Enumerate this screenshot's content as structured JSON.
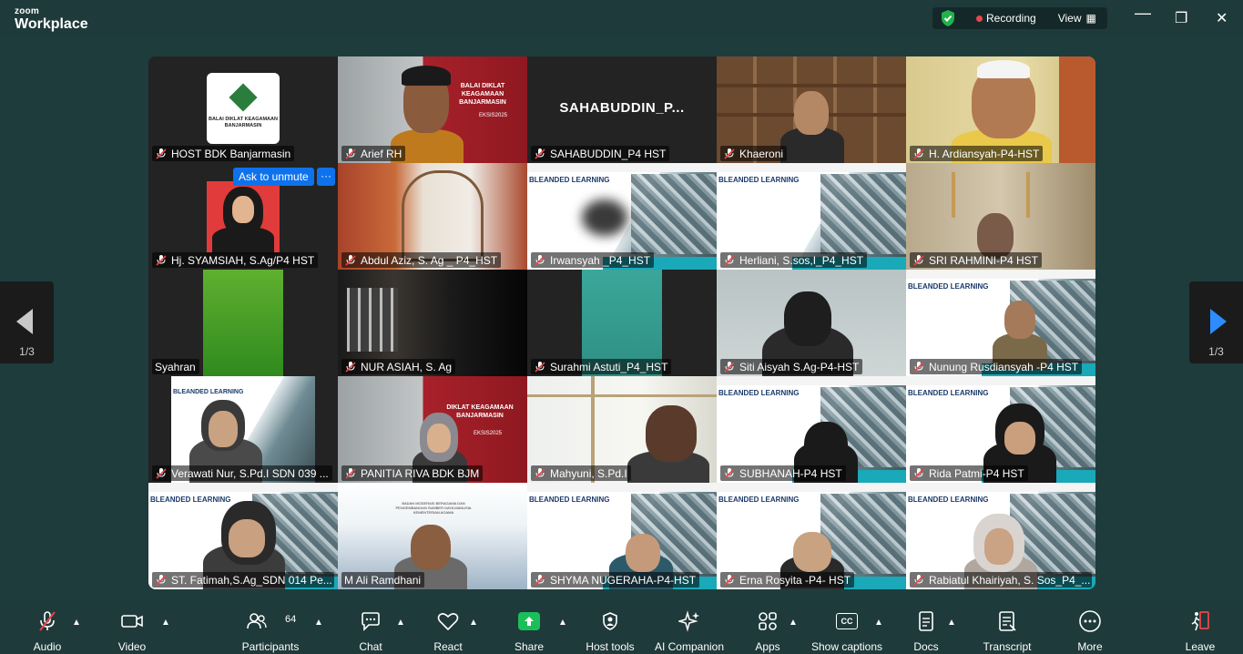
{
  "app": {
    "brand_small": "zoom",
    "brand_large": "Workplace"
  },
  "header": {
    "recording_label": "Recording",
    "view_label": "View"
  },
  "gallery": {
    "page_left": "1/3",
    "page_right": "1/3",
    "tiles": [
      {
        "name": "HOST BDK Banjarmasin",
        "logo_text": "BALAI DIKLAT KEAGAMAAN BANJARMASIN"
      },
      {
        "name": "Arief RH",
        "slide_title": "BALAI DIKLAT KEAGAMAAN BANJARMASIN",
        "slide_sub": "EKSIS2025"
      },
      {
        "name": "SAHABUDDIN_P4 HST",
        "big_name": "SAHABUDDIN_P..."
      },
      {
        "name": "Khaeroni"
      },
      {
        "name": "H. Ardiansyah-P4-HST"
      },
      {
        "name": "Hj. SYAMSIAH, S.Ag/P4 HST",
        "ask_unmute": "Ask to unmute",
        "more": "···"
      },
      {
        "name": "Abdul Aziz, S. Ag _ P4_HST"
      },
      {
        "name": "Irwansyah _P4_HST",
        "slide_title": "BLEANDED LEARNING"
      },
      {
        "name": "Herliani, S.sos,I_P4_HST",
        "slide_title": "BLEANDED LEARNING"
      },
      {
        "name": "SRI RAHMINI-P4 HST"
      },
      {
        "name": "Syahran"
      },
      {
        "name": "NUR ASIAH, S. Ag"
      },
      {
        "name": "Surahmi Astuti_P4_HST"
      },
      {
        "name": "Siti Aisyah S.Ag-P4-HST"
      },
      {
        "name": "Nunung Rusdiansyah -P4 HST",
        "slide_title": "BLEANDED LEARNING"
      },
      {
        "name": "Verawati Nur, S.Pd.I SDN 039 ...",
        "slide_title": "BLEANDED LEARNING"
      },
      {
        "name": "PANITIA RIVA BDK BJM",
        "slide_title": "DIKLAT KEAGAMAAN BANJARMASIN",
        "slide_sub": "EKSIS2025"
      },
      {
        "name": "Mahyuni, S.Pd.I"
      },
      {
        "name": "SUBHANAH-P4 HST",
        "slide_title": "BLEANDED LEARNING"
      },
      {
        "name": "Rida Patmi-P4 HST",
        "slide_title": "BLEANDED LEARNING"
      },
      {
        "name": "ST. Fatimah,S.Ag_SDN 014 Pe...",
        "slide_title": "BLEANDED LEARNING"
      },
      {
        "name": "M Ali Ramdhani",
        "slide_title": "BADAN MODERASI BERAGAMA DAN PENGEMBANGAN SUMBER DAYA MANUSIA KEMENTERIAN AGAMA"
      },
      {
        "name": "SHYMA NUGERAHA-P4-HST",
        "slide_title": "BLEANDED LEARNING"
      },
      {
        "name": "Erna Rosyita -P4- HST",
        "slide_title": "BLEANDED LEARNING"
      },
      {
        "name": "Rabiatul Khairiyah, S. Sos_P4_...",
        "slide_title": "BLEANDED LEARNING"
      }
    ]
  },
  "toolbar": {
    "audio": "Audio",
    "video": "Video",
    "participants": "Participants",
    "participants_count": "64",
    "chat": "Chat",
    "react": "React",
    "share": "Share",
    "host_tools": "Host tools",
    "ai_companion": "AI Companion",
    "apps": "Apps",
    "show_captions": "Show captions",
    "captions_icon": "CC",
    "docs": "Docs",
    "transcript": "Transcript",
    "more": "More",
    "leave": "Leave"
  },
  "colors": {
    "accent": "#0e72ed",
    "active_speaker": "#2ec26a",
    "recording": "#e8474a",
    "share": "#1bbf5a",
    "background": "#1e3c3c"
  }
}
